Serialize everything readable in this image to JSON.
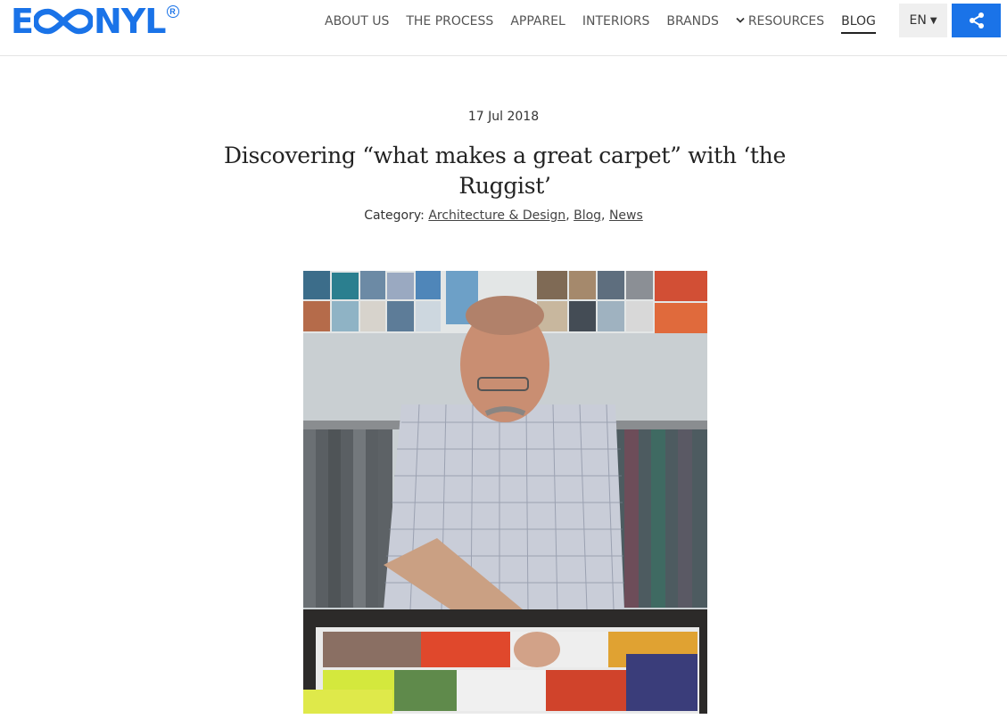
{
  "header": {
    "logo_text_left": "E",
    "logo_text_right": "NYL",
    "brand_color": "#1a73e8",
    "nav": [
      {
        "label": "ABOUT US"
      },
      {
        "label": "THE PROCESS"
      },
      {
        "label": "APPAREL"
      },
      {
        "label": "INTERIORS"
      },
      {
        "label": "BRANDS"
      },
      {
        "label": "RESOURCES"
      },
      {
        "label": "BLOG"
      }
    ],
    "active_nav": "BLOG",
    "language": "EN",
    "share_icon": "share-icon"
  },
  "article": {
    "date": "17 Jul 2018",
    "title": "Discovering “what makes a great carpet” with ‘the Ruggist’",
    "category_label": "Category:",
    "categories": [
      "Architecture & Design",
      "Blog",
      "News"
    ],
    "image_icon": "photo-man-with-carpet-samples"
  }
}
